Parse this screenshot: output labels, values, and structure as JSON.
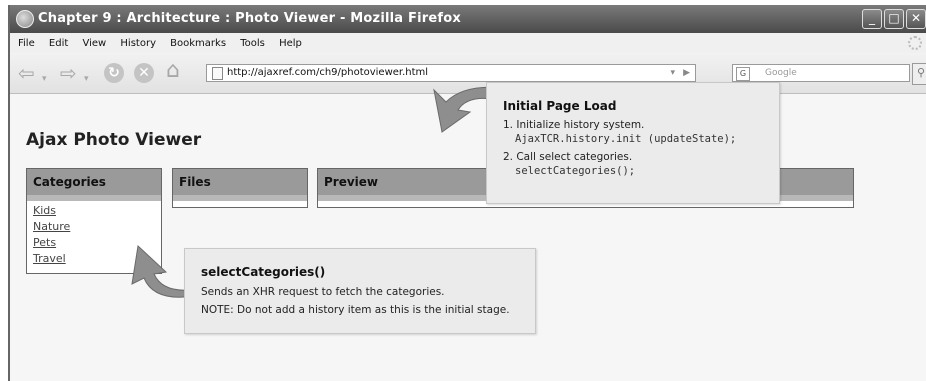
{
  "window": {
    "title": "Chapter 9 : Architecture : Photo Viewer - Mozilla Firefox",
    "controls": {
      "minimize": "_",
      "maximize": "□",
      "close": "✕"
    }
  },
  "menu": {
    "items": [
      "File",
      "Edit",
      "View",
      "History",
      "Bookmarks",
      "Tools",
      "Help"
    ]
  },
  "toolbar": {
    "url": "http://ajaxref.com/ch9/photoviewer.html",
    "search_placeholder": "Google",
    "icons": [
      "back-icon",
      "forward-icon",
      "reload-icon",
      "stop-icon",
      "home-icon",
      "page-icon",
      "search-engine-icon",
      "search-icon"
    ]
  },
  "app": {
    "title": "Ajax Photo Viewer",
    "panels": {
      "categories": "Categories",
      "files": "Files",
      "preview": "Preview"
    },
    "categories": [
      "Kids",
      "Nature",
      "Pets",
      "Travel"
    ]
  },
  "callouts": {
    "initial_load": {
      "title": "Initial Page Load",
      "step1": "1. Initialize history system.",
      "step1_code": "AjaxTCR.history.init (updateState);",
      "step2": "2. Call select categories.",
      "step2_code": "selectCategories();"
    },
    "select_categories": {
      "title": "selectCategories()",
      "line1": "Sends an XHR request to fetch the categories.",
      "line2": "NOTE: Do not add a history item as this is the initial stage."
    }
  }
}
